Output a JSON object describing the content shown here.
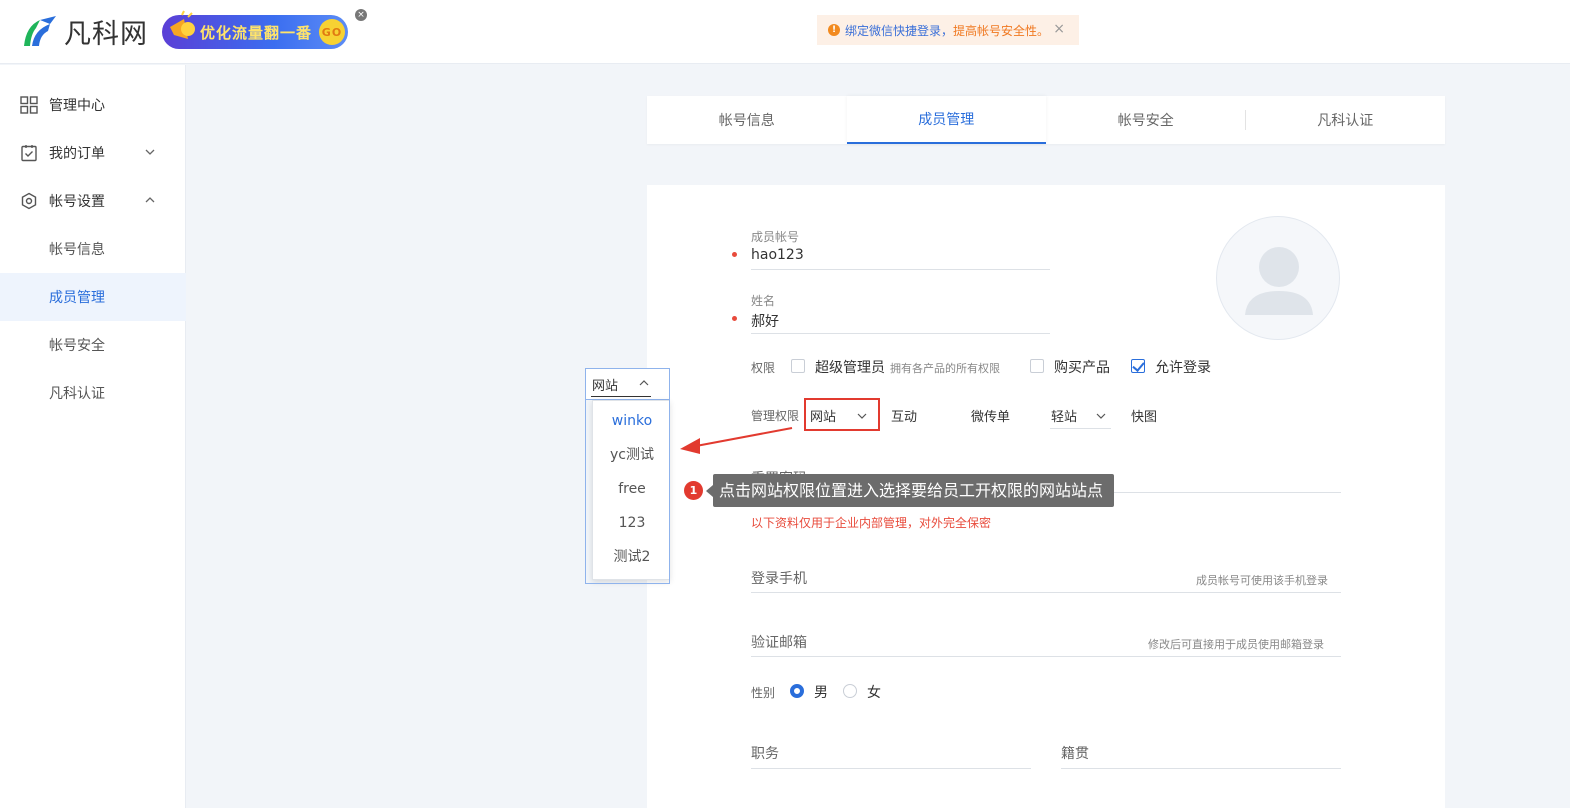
{
  "header": {
    "logo_text": "凡科网",
    "promo_text": "优化流量翻一番",
    "promo_go": "GO",
    "promo_close": "×",
    "notice_icon": "!",
    "notice_text_a": "绑定微信快捷登录，",
    "notice_text_b": "提高帐号安全性。",
    "notice_close": "×"
  },
  "sidebar": {
    "items": [
      {
        "label": "管理中心",
        "icon": "grid-icon"
      },
      {
        "label": "我的订单",
        "icon": "clipboard-check-icon"
      },
      {
        "label": "帐号设置",
        "icon": "hexagon-gear-icon"
      },
      {
        "label": "帐号信息"
      },
      {
        "label": "成员管理"
      },
      {
        "label": "帐号安全"
      },
      {
        "label": "凡科认证"
      }
    ],
    "active_index": 4
  },
  "tabs": [
    "帐号信息",
    "成员管理",
    "帐号安全",
    "凡科认证"
  ],
  "form": {
    "member_account_label": "成员帐号",
    "member_account_value": "hao123",
    "name_label": "姓名",
    "name_value": "郝好",
    "perm_label": "权限",
    "super_admin": "超级管理员",
    "super_admin_hint": "拥有各产品的所有权限",
    "buy_product": "购买产品",
    "allow_login": "允许登录",
    "manage_perm_label": "管理权限",
    "perm_site": "网站",
    "perm_interact": "互动",
    "perm_flyer": "微传单",
    "perm_light": "轻站",
    "perm_quick": "快图",
    "reset_pwd_label": "重置密码",
    "privacy_tip": "以下资料仅用于企业内部管理，对外完全保密",
    "phone_label": "登录手机",
    "phone_hint": "成员帐号可使用该手机登录",
    "email_label": "验证邮箱",
    "email_hint": "修改后可直接用于成员使用邮箱登录",
    "gender_label": "性别",
    "gender_male": "男",
    "gender_female": "女",
    "job_label": "职务",
    "origin_label": "籍贯"
  },
  "dropdown": {
    "selected": "网站",
    "options": [
      "winko",
      "yc测试",
      "free",
      "123",
      "测试2"
    ]
  },
  "guide": {
    "step": "1",
    "tip": "点击网站权限位置进入选择要给员工开权限的网站站点"
  },
  "colors": {
    "accent": "#2a6edb",
    "required": "#e84b3c",
    "notice_bg": "#fdf0e6"
  }
}
